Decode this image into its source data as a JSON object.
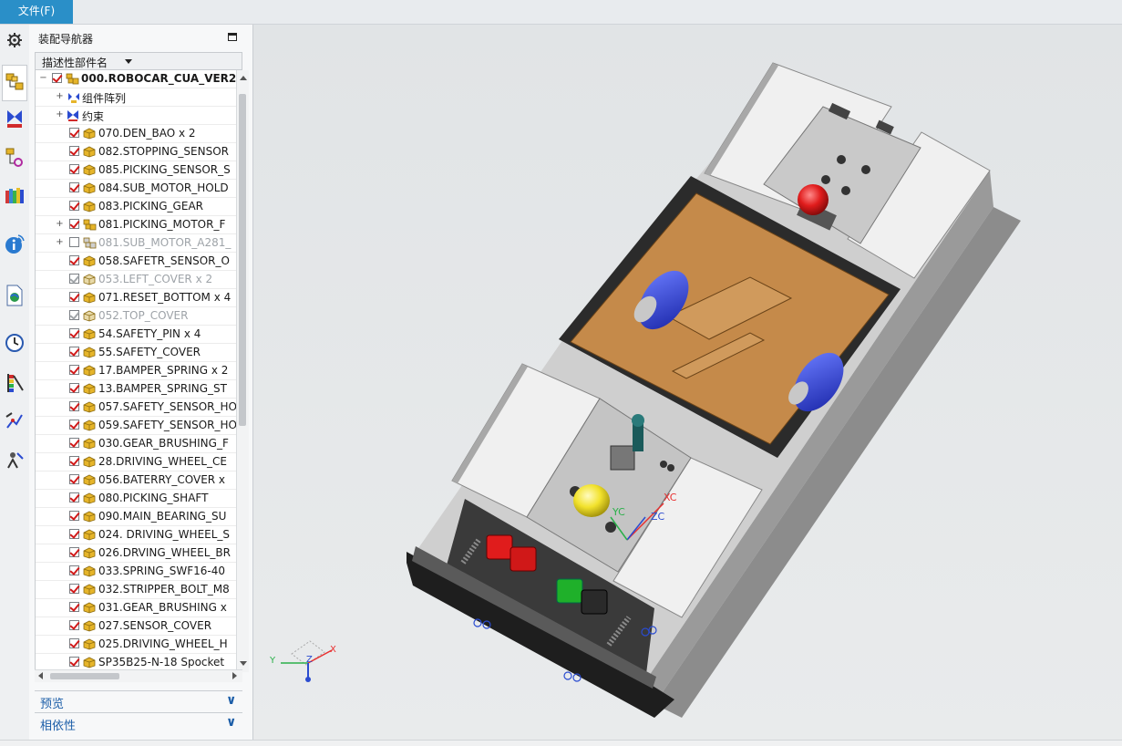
{
  "menu": {
    "file_label": "文件(F)"
  },
  "navigator": {
    "title": "装配导航器",
    "column_header": "描述性部件名",
    "rows": [
      {
        "label": "000.ROBOCAR_CUA_VER2.",
        "state": "checked",
        "expander": "minus",
        "indent": 0,
        "icon": "assembly-icon",
        "style": "bold"
      },
      {
        "label": "组件阵列",
        "state": "none",
        "expander": "plus",
        "indent": 1,
        "icon": "component-array-icon",
        "style": "normal"
      },
      {
        "label": "约束",
        "state": "none",
        "expander": "plus",
        "indent": 1,
        "icon": "constraint-icon",
        "style": "normal"
      },
      {
        "label": "070.DEN_BAO x 2",
        "state": "checked",
        "expander": "",
        "indent": 1,
        "icon": "part-icon",
        "style": "normal"
      },
      {
        "label": "082.STOPPING_SENSOR",
        "state": "checked",
        "expander": "",
        "indent": 1,
        "icon": "part-icon",
        "style": "normal"
      },
      {
        "label": "085.PICKING_SENSOR_S",
        "state": "checked",
        "expander": "",
        "indent": 1,
        "icon": "part-icon",
        "style": "normal"
      },
      {
        "label": "084.SUB_MOTOR_HOLD",
        "state": "checked",
        "expander": "",
        "indent": 1,
        "icon": "part-icon",
        "style": "normal"
      },
      {
        "label": "083.PICKING_GEAR",
        "state": "checked",
        "expander": "",
        "indent": 1,
        "icon": "part-icon",
        "style": "normal"
      },
      {
        "label": "081.PICKING_MOTOR_F",
        "state": "checked",
        "expander": "plus",
        "indent": 1,
        "icon": "assembly-icon",
        "style": "normal"
      },
      {
        "label": "081.SUB_MOTOR_A281_",
        "state": "unchecked",
        "expander": "plus",
        "indent": 1,
        "icon": "assembly-icon",
        "style": "dim"
      },
      {
        "label": "058.SAFETR_SENSOR_O",
        "state": "checked",
        "expander": "",
        "indent": 1,
        "icon": "part-icon",
        "style": "normal"
      },
      {
        "label": "053.LEFT_COVER x 2",
        "state": "grey",
        "expander": "",
        "indent": 1,
        "icon": "part-icon",
        "style": "dim"
      },
      {
        "label": "071.RESET_BOTTOM x 4",
        "state": "checked",
        "expander": "",
        "indent": 1,
        "icon": "part-icon",
        "style": "normal"
      },
      {
        "label": "052.TOP_COVER",
        "state": "grey",
        "expander": "",
        "indent": 1,
        "icon": "part-icon",
        "style": "dim"
      },
      {
        "label": "54.SAFETY_PIN x 4",
        "state": "checked",
        "expander": "",
        "indent": 1,
        "icon": "part-icon",
        "style": "normal"
      },
      {
        "label": "55.SAFETY_COVER",
        "state": "checked",
        "expander": "",
        "indent": 1,
        "icon": "part-icon",
        "style": "normal"
      },
      {
        "label": "17.BAMPER_SPRING x 2",
        "state": "checked",
        "expander": "",
        "indent": 1,
        "icon": "part-icon",
        "style": "normal"
      },
      {
        "label": "13.BAMPER_SPRING_ST",
        "state": "checked",
        "expander": "",
        "indent": 1,
        "icon": "part-icon",
        "style": "normal"
      },
      {
        "label": "057.SAFETY_SENSOR_HO",
        "state": "checked",
        "expander": "",
        "indent": 1,
        "icon": "part-icon",
        "style": "normal"
      },
      {
        "label": "059.SAFETY_SENSOR_HO",
        "state": "checked",
        "expander": "",
        "indent": 1,
        "icon": "part-icon",
        "style": "normal"
      },
      {
        "label": "030.GEAR_BRUSHING_F",
        "state": "checked",
        "expander": "",
        "indent": 1,
        "icon": "part-icon",
        "style": "normal"
      },
      {
        "label": "28.DRIVING_WHEEL_CE",
        "state": "checked",
        "expander": "",
        "indent": 1,
        "icon": "part-icon",
        "style": "normal"
      },
      {
        "label": "056.BATERRY_COVER x",
        "state": "checked",
        "expander": "",
        "indent": 1,
        "icon": "part-icon",
        "style": "normal"
      },
      {
        "label": "080.PICKING_SHAFT",
        "state": "checked",
        "expander": "",
        "indent": 1,
        "icon": "part-icon",
        "style": "normal"
      },
      {
        "label": "090.MAIN_BEARING_SU",
        "state": "checked",
        "expander": "",
        "indent": 1,
        "icon": "part-icon",
        "style": "normal"
      },
      {
        "label": "024. DRIVING_WHEEL_S",
        "state": "checked",
        "expander": "",
        "indent": 1,
        "icon": "part-icon",
        "style": "normal"
      },
      {
        "label": "026.DRVING_WHEEL_BR",
        "state": "checked",
        "expander": "",
        "indent": 1,
        "icon": "part-icon",
        "style": "normal"
      },
      {
        "label": "033.SPRING_SWF16-40",
        "state": "checked",
        "expander": "",
        "indent": 1,
        "icon": "part-icon",
        "style": "normal"
      },
      {
        "label": "032.STRIPPER_BOLT_M8",
        "state": "checked",
        "expander": "",
        "indent": 1,
        "icon": "part-icon",
        "style": "normal"
      },
      {
        "label": "031.GEAR_BRUSHING x",
        "state": "checked",
        "expander": "",
        "indent": 1,
        "icon": "part-icon",
        "style": "normal"
      },
      {
        "label": "027.SENSOR_COVER",
        "state": "checked",
        "expander": "",
        "indent": 1,
        "icon": "part-icon",
        "style": "normal"
      },
      {
        "label": "025.DRIVING_WHEEL_H",
        "state": "checked",
        "expander": "",
        "indent": 1,
        "icon": "part-icon",
        "style": "normal"
      },
      {
        "label": "SP35B25-N-18 Spocket",
        "state": "checked",
        "expander": "",
        "indent": 1,
        "icon": "part-icon",
        "style": "normal"
      }
    ],
    "sections": [
      {
        "label": "预览"
      },
      {
        "label": "相依性"
      }
    ]
  },
  "rail_icons": [
    "settings-gear-icon",
    "assembly-navigator-icon",
    "constraint-navigator-icon",
    "part-navigator-icon",
    "reuse-library-icon",
    "info-icon",
    "web-browser-icon",
    "history-icon",
    "palette-icon",
    "process-studio-icon",
    "roles-icon"
  ],
  "viewport": {
    "triad_labels": {
      "x": "X",
      "y": "Y",
      "z": "Z"
    },
    "wcs_labels": {
      "xc": "XC",
      "yc": "YC",
      "zc": "ZC"
    }
  },
  "colors": {
    "file_menu_bg": "#2a8fc8",
    "check_red": "#d11a1a",
    "part_yellow": "#e6b52a",
    "board_brown": "#c58a4a",
    "wheel_blue": "#2b3fd6",
    "button_red": "#e01c1c",
    "button_yellow": "#f2e22c",
    "button_green": "#1fb02a"
  }
}
